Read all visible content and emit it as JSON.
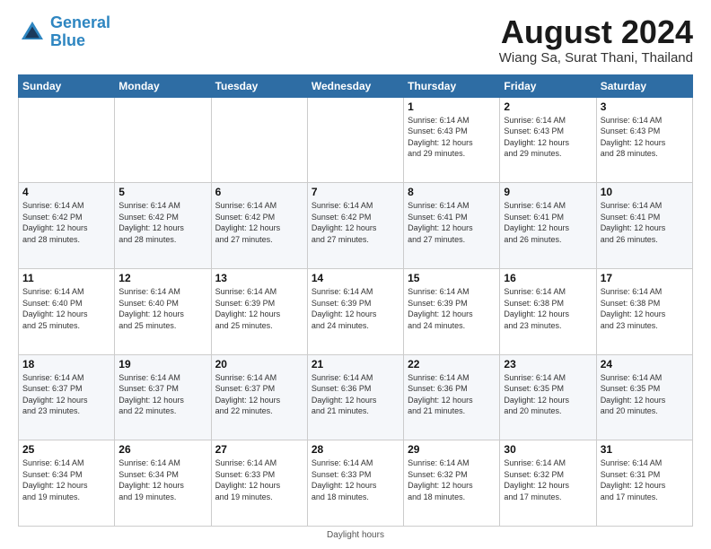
{
  "logo": {
    "line1": "General",
    "line2": "Blue"
  },
  "title": "August 2024",
  "subtitle": "Wiang Sa, Surat Thani, Thailand",
  "days_header": [
    "Sunday",
    "Monday",
    "Tuesday",
    "Wednesday",
    "Thursday",
    "Friday",
    "Saturday"
  ],
  "footer": "Daylight hours",
  "weeks": [
    [
      {
        "day": "",
        "info": ""
      },
      {
        "day": "",
        "info": ""
      },
      {
        "day": "",
        "info": ""
      },
      {
        "day": "",
        "info": ""
      },
      {
        "day": "1",
        "info": "Sunrise: 6:14 AM\nSunset: 6:43 PM\nDaylight: 12 hours\nand 29 minutes."
      },
      {
        "day": "2",
        "info": "Sunrise: 6:14 AM\nSunset: 6:43 PM\nDaylight: 12 hours\nand 29 minutes."
      },
      {
        "day": "3",
        "info": "Sunrise: 6:14 AM\nSunset: 6:43 PM\nDaylight: 12 hours\nand 28 minutes."
      }
    ],
    [
      {
        "day": "4",
        "info": "Sunrise: 6:14 AM\nSunset: 6:42 PM\nDaylight: 12 hours\nand 28 minutes."
      },
      {
        "day": "5",
        "info": "Sunrise: 6:14 AM\nSunset: 6:42 PM\nDaylight: 12 hours\nand 28 minutes."
      },
      {
        "day": "6",
        "info": "Sunrise: 6:14 AM\nSunset: 6:42 PM\nDaylight: 12 hours\nand 27 minutes."
      },
      {
        "day": "7",
        "info": "Sunrise: 6:14 AM\nSunset: 6:42 PM\nDaylight: 12 hours\nand 27 minutes."
      },
      {
        "day": "8",
        "info": "Sunrise: 6:14 AM\nSunset: 6:41 PM\nDaylight: 12 hours\nand 27 minutes."
      },
      {
        "day": "9",
        "info": "Sunrise: 6:14 AM\nSunset: 6:41 PM\nDaylight: 12 hours\nand 26 minutes."
      },
      {
        "day": "10",
        "info": "Sunrise: 6:14 AM\nSunset: 6:41 PM\nDaylight: 12 hours\nand 26 minutes."
      }
    ],
    [
      {
        "day": "11",
        "info": "Sunrise: 6:14 AM\nSunset: 6:40 PM\nDaylight: 12 hours\nand 25 minutes."
      },
      {
        "day": "12",
        "info": "Sunrise: 6:14 AM\nSunset: 6:40 PM\nDaylight: 12 hours\nand 25 minutes."
      },
      {
        "day": "13",
        "info": "Sunrise: 6:14 AM\nSunset: 6:39 PM\nDaylight: 12 hours\nand 25 minutes."
      },
      {
        "day": "14",
        "info": "Sunrise: 6:14 AM\nSunset: 6:39 PM\nDaylight: 12 hours\nand 24 minutes."
      },
      {
        "day": "15",
        "info": "Sunrise: 6:14 AM\nSunset: 6:39 PM\nDaylight: 12 hours\nand 24 minutes."
      },
      {
        "day": "16",
        "info": "Sunrise: 6:14 AM\nSunset: 6:38 PM\nDaylight: 12 hours\nand 23 minutes."
      },
      {
        "day": "17",
        "info": "Sunrise: 6:14 AM\nSunset: 6:38 PM\nDaylight: 12 hours\nand 23 minutes."
      }
    ],
    [
      {
        "day": "18",
        "info": "Sunrise: 6:14 AM\nSunset: 6:37 PM\nDaylight: 12 hours\nand 23 minutes."
      },
      {
        "day": "19",
        "info": "Sunrise: 6:14 AM\nSunset: 6:37 PM\nDaylight: 12 hours\nand 22 minutes."
      },
      {
        "day": "20",
        "info": "Sunrise: 6:14 AM\nSunset: 6:37 PM\nDaylight: 12 hours\nand 22 minutes."
      },
      {
        "day": "21",
        "info": "Sunrise: 6:14 AM\nSunset: 6:36 PM\nDaylight: 12 hours\nand 21 minutes."
      },
      {
        "day": "22",
        "info": "Sunrise: 6:14 AM\nSunset: 6:36 PM\nDaylight: 12 hours\nand 21 minutes."
      },
      {
        "day": "23",
        "info": "Sunrise: 6:14 AM\nSunset: 6:35 PM\nDaylight: 12 hours\nand 20 minutes."
      },
      {
        "day": "24",
        "info": "Sunrise: 6:14 AM\nSunset: 6:35 PM\nDaylight: 12 hours\nand 20 minutes."
      }
    ],
    [
      {
        "day": "25",
        "info": "Sunrise: 6:14 AM\nSunset: 6:34 PM\nDaylight: 12 hours\nand 19 minutes."
      },
      {
        "day": "26",
        "info": "Sunrise: 6:14 AM\nSunset: 6:34 PM\nDaylight: 12 hours\nand 19 minutes."
      },
      {
        "day": "27",
        "info": "Sunrise: 6:14 AM\nSunset: 6:33 PM\nDaylight: 12 hours\nand 19 minutes."
      },
      {
        "day": "28",
        "info": "Sunrise: 6:14 AM\nSunset: 6:33 PM\nDaylight: 12 hours\nand 18 minutes."
      },
      {
        "day": "29",
        "info": "Sunrise: 6:14 AM\nSunset: 6:32 PM\nDaylight: 12 hours\nand 18 minutes."
      },
      {
        "day": "30",
        "info": "Sunrise: 6:14 AM\nSunset: 6:32 PM\nDaylight: 12 hours\nand 17 minutes."
      },
      {
        "day": "31",
        "info": "Sunrise: 6:14 AM\nSunset: 6:31 PM\nDaylight: 12 hours\nand 17 minutes."
      }
    ]
  ]
}
